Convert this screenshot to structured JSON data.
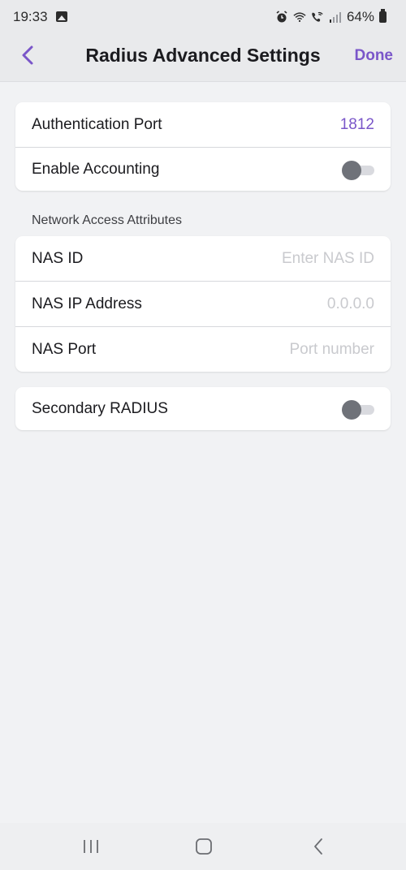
{
  "status_bar": {
    "time": "19:33",
    "battery_percent": "64%",
    "icons": [
      "gallery-icon",
      "alarm-icon",
      "wifi-icon",
      "wifi-calling-icon",
      "signal-icon",
      "battery-icon"
    ]
  },
  "header": {
    "title": "Radius Advanced Settings",
    "done_label": "Done",
    "back_icon": "chevron-left-icon"
  },
  "colors": {
    "accent": "#7a56c9",
    "background": "#f1f2f4",
    "card": "#ffffff",
    "toggle_off": "#6f7279"
  },
  "card_main": {
    "auth_port_label": "Authentication Port",
    "auth_port_value": "1812",
    "accounting_label": "Enable Accounting",
    "accounting_enabled": false
  },
  "section_nas": {
    "heading": "Network Access Attributes",
    "nas_id_label": "NAS ID",
    "nas_id_placeholder": "Enter NAS ID",
    "nas_ip_label": "NAS IP Address",
    "nas_ip_placeholder": "0.0.0.0",
    "nas_port_label": "NAS Port",
    "nas_port_placeholder": "Port number"
  },
  "card_secondary": {
    "label": "Secondary RADIUS",
    "enabled": false
  },
  "nav_bar": {
    "icons": [
      "recent-apps-icon",
      "home-icon",
      "back-icon"
    ]
  }
}
